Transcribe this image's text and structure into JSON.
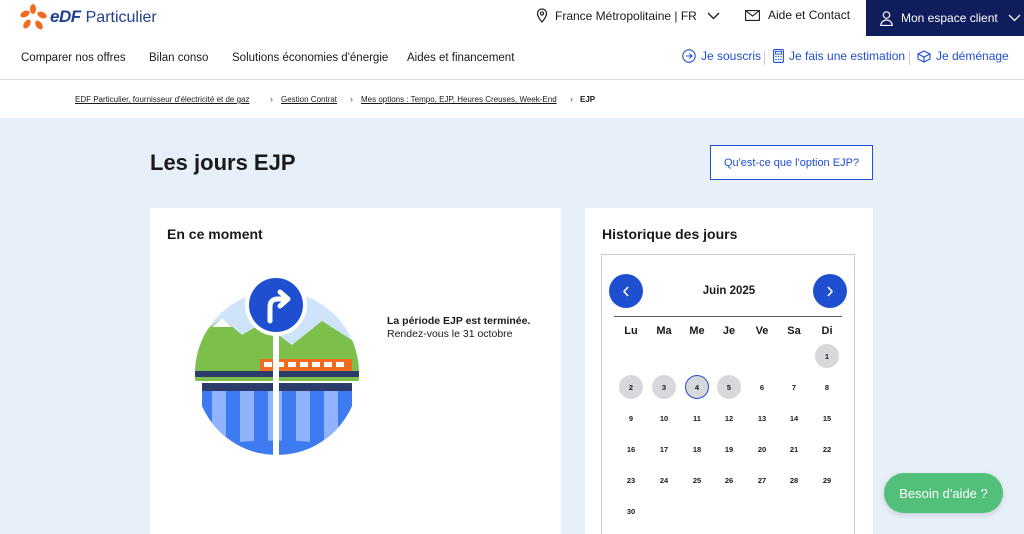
{
  "brand": {
    "logo_text": "eDF",
    "sub": "Particulier"
  },
  "topbar": {
    "region": "France Métropolitaine | FR",
    "contact": "Aide et Contact",
    "client": "Mon espace client"
  },
  "nav": {
    "items": [
      "Comparer nos offres",
      "Bilan conso",
      "Solutions économies d'énergie",
      "Aides et financement"
    ],
    "actions": [
      "Je souscris",
      "Je fais une estimation",
      "Je déménage"
    ]
  },
  "breadcrumb": {
    "items": [
      "EDF Particulier, fournisseur d'électricité et de gaz",
      "Gestion Contrat",
      "Mes options : Tempo, EJP, Heures Creuses, Week-End"
    ],
    "current": "EJP"
  },
  "page": {
    "title": "Les jours EJP",
    "what_button": "Qu'est-ce que l'option EJP?"
  },
  "moment": {
    "title": "En ce moment",
    "status_bold": "La période EJP est terminée.",
    "status_text": " Rendez-vous le 31 octobre"
  },
  "history": {
    "title": "Historique des jours",
    "month": "Juin 2025",
    "weekdays": [
      "Lu",
      "Ma",
      "Me",
      "Je",
      "Ve",
      "Sa",
      "Di"
    ],
    "days": [
      "1",
      "2",
      "3",
      "4",
      "5",
      "6",
      "7",
      "8",
      "9",
      "10",
      "11",
      "12",
      "13",
      "14",
      "15",
      "16",
      "17",
      "18",
      "19",
      "20",
      "21",
      "22",
      "23",
      "24",
      "25",
      "26",
      "27",
      "28",
      "29",
      "30"
    ],
    "past_days": [
      "1",
      "2",
      "3",
      "5"
    ],
    "today": "4"
  },
  "help": {
    "label": "Besoin d'aide ?"
  },
  "colors": {
    "primary": "#1f4fd1",
    "navy": "#0f1d5c",
    "help_green": "#52c07a",
    "page_bg": "#e7eff9"
  }
}
